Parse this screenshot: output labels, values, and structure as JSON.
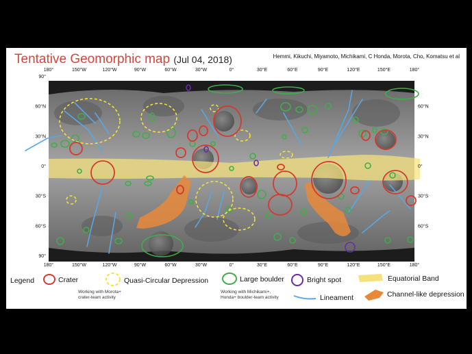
{
  "title": {
    "main": "Tentative Geomorphic map",
    "date": "(Jul 04, 2018)"
  },
  "authors": "Hemmi, Kikuchi, Miyamoto, Michikami, C Honda, Morota, Cho, Komatsu et al",
  "map": {
    "top_lon_labels": [
      "180°",
      "150°W",
      "120°W",
      "90°W",
      "60°W",
      "30°W",
      "0°",
      "30°E",
      "60°E",
      "90°E",
      "120°E",
      "150°E",
      "180°"
    ],
    "bottom_lon_labels": [
      "180°",
      "150°W",
      "120°W",
      "90°W",
      "60°W",
      "30°W",
      "0°",
      "30°E",
      "60°E",
      "90°E",
      "120°E",
      "150°E",
      "180°"
    ],
    "left_lat_labels": [
      "90°",
      "60°N",
      "30°N",
      "0°",
      "30°S",
      "60°S",
      "90°"
    ],
    "right_lat_labels": [
      "60°N",
      "30°N",
      "0°",
      "30°S",
      "60°S"
    ]
  },
  "legend": {
    "heading": "Legend",
    "crater": "Crater",
    "quasi": "Quasi-Circular Depression",
    "boulder": "Large boulder",
    "bright": "Bright spot",
    "band": "Equatorial Band",
    "lineament": "Lineament",
    "channel": "Channel-like depression",
    "note_crater": [
      "Working with Morota+",
      "crater-team activity"
    ],
    "note_boulder": [
      "Working with Michikami+,",
      "Honda+ boulder-team activity"
    ]
  },
  "colors": {
    "title": "#d2473c",
    "crater": "#d23a2e",
    "quasi": "#f2e23a",
    "boulder": "#3fae49",
    "bright": "#6a2aa8",
    "band": "#f5e27a",
    "lineament": "#5aa7e3",
    "channel": "#e8893a"
  }
}
